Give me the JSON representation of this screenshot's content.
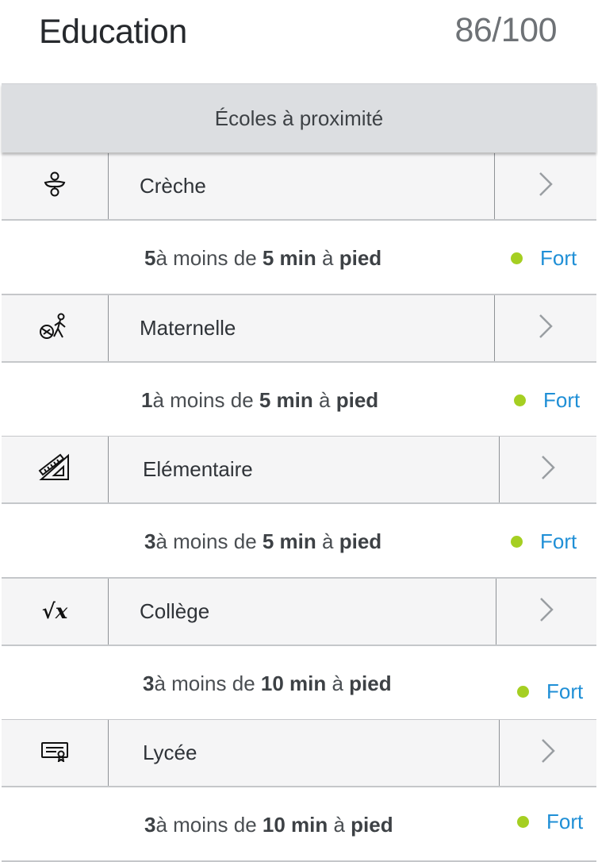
{
  "header": {
    "title": "Education",
    "score": "86/100"
  },
  "section": {
    "title": "Écoles à proximité"
  },
  "categories": [
    {
      "label": "Crèche",
      "icon": "pacifier-icon",
      "count": "5",
      "within": "à moins de ",
      "minutes": "5 min",
      "by": " à ",
      "mode": "pied",
      "rating": "Fort",
      "rating_color": "#a5cf22"
    },
    {
      "label": "Maternelle",
      "icon": "child-ball-icon",
      "count": "1",
      "within": "à moins de ",
      "minutes": "5 min",
      "by": " à ",
      "mode": "pied",
      "rating": "Fort",
      "rating_color": "#a5cf22"
    },
    {
      "label": "Elémentaire",
      "icon": "ruler-triangle-icon",
      "count": "3",
      "within": "à moins de ",
      "minutes": "5 min",
      "by": " à ",
      "mode": "pied",
      "rating": "Fort",
      "rating_color": "#a5cf22"
    },
    {
      "label": "Collège",
      "icon": "square-root-icon",
      "count": "3",
      "within": "à moins de ",
      "minutes": "10 min",
      "by": " à ",
      "mode": "pied",
      "rating": "Fort",
      "rating_color": "#a5cf22"
    },
    {
      "label": "Lycée",
      "icon": "diploma-icon",
      "count": "3",
      "within": "à moins de ",
      "minutes": "10 min",
      "by": " à ",
      "mode": "pied",
      "rating": "Fort",
      "rating_color": "#a5cf22"
    }
  ],
  "colors": {
    "accent_link": "#1f8fd6",
    "section_header_bg": "#dcdee1",
    "category_row_bg": "#f5f5f6"
  }
}
